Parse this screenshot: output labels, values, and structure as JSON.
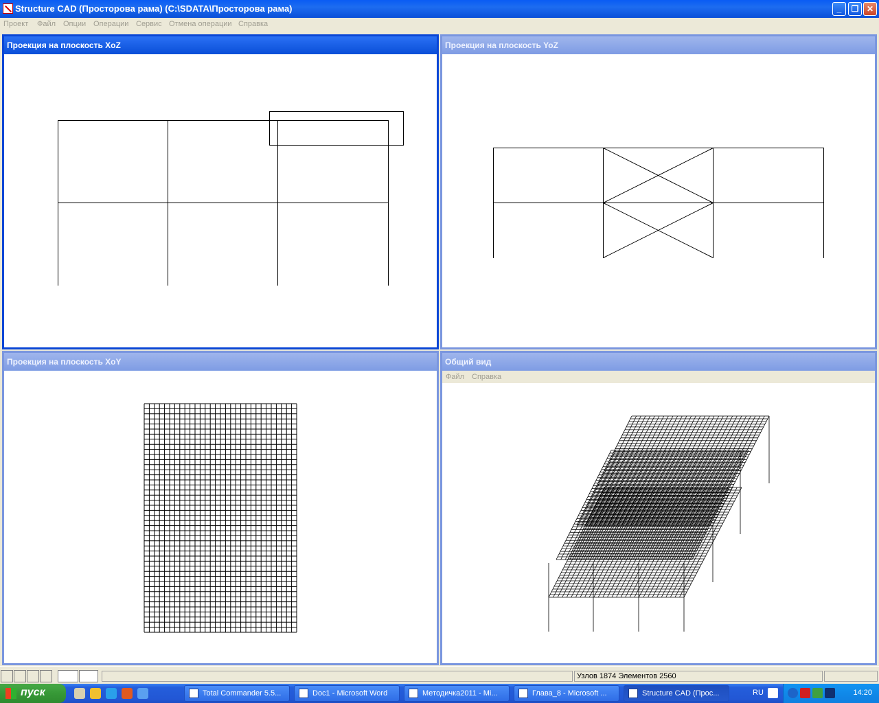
{
  "window": {
    "title": "Structure CAD (Просторова рама) (C:\\SDATA\\Просторова рама)",
    "minimize": "_",
    "restore": "❐",
    "close": "✕"
  },
  "menu": [
    "Проект",
    "Файл",
    "Опции",
    "Операции",
    "Сервис",
    "Отмена операции",
    "Справка"
  ],
  "panels": {
    "xoz": {
      "title": "Проекция на плоскость XoZ"
    },
    "yoz": {
      "title": "Проекция на плоскость YoZ"
    },
    "xoy": {
      "title": "Проекция на плоскость XoY"
    },
    "general": {
      "title": "Общий вид",
      "menu": [
        "Файл",
        "Справка"
      ]
    }
  },
  "status": {
    "nodes_elements": "Узлов 1874 Элементов 2560"
  },
  "taskbar": {
    "start": "пуск",
    "tasks": [
      "Total Commander 5.5...",
      "Doc1 - Microsoft Word",
      "Методичка2011 - Mi...",
      "Глава_8 - Microsoft ...",
      "Structure CAD (Прос..."
    ],
    "lang": "RU",
    "clock": "14:20"
  },
  "colors": {
    "titlebar": "#0a5cf4",
    "taskbar": "#245edb",
    "start": "#379937",
    "tray": "#0f7fe0"
  }
}
